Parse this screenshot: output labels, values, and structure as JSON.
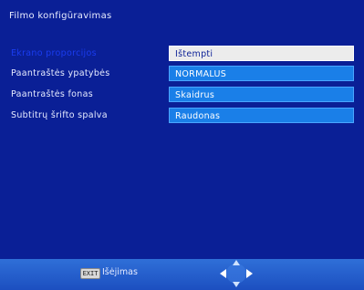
{
  "screen_title": "Filmo konfigūravimas",
  "settings": [
    {
      "label": "Ekrano proporcijos",
      "value": "Ištempti"
    },
    {
      "label": "Paantraštės ypatybės",
      "value": "NORMALUS"
    },
    {
      "label": "Paantraštės fonas",
      "value": "Skaidrus"
    },
    {
      "label": "Subtitrų šrifto spalva",
      "value": "Raudonas"
    }
  ],
  "footer": {
    "exit_key": "EXIT",
    "exit_label": "Išėjimas",
    "nav_icon": "dpad-arrows-icon"
  },
  "colors": {
    "background": "#0a1f96",
    "value_field": "#1a7fe8",
    "selected_field": "#ececec",
    "selected_label": "#1a3cf0"
  }
}
